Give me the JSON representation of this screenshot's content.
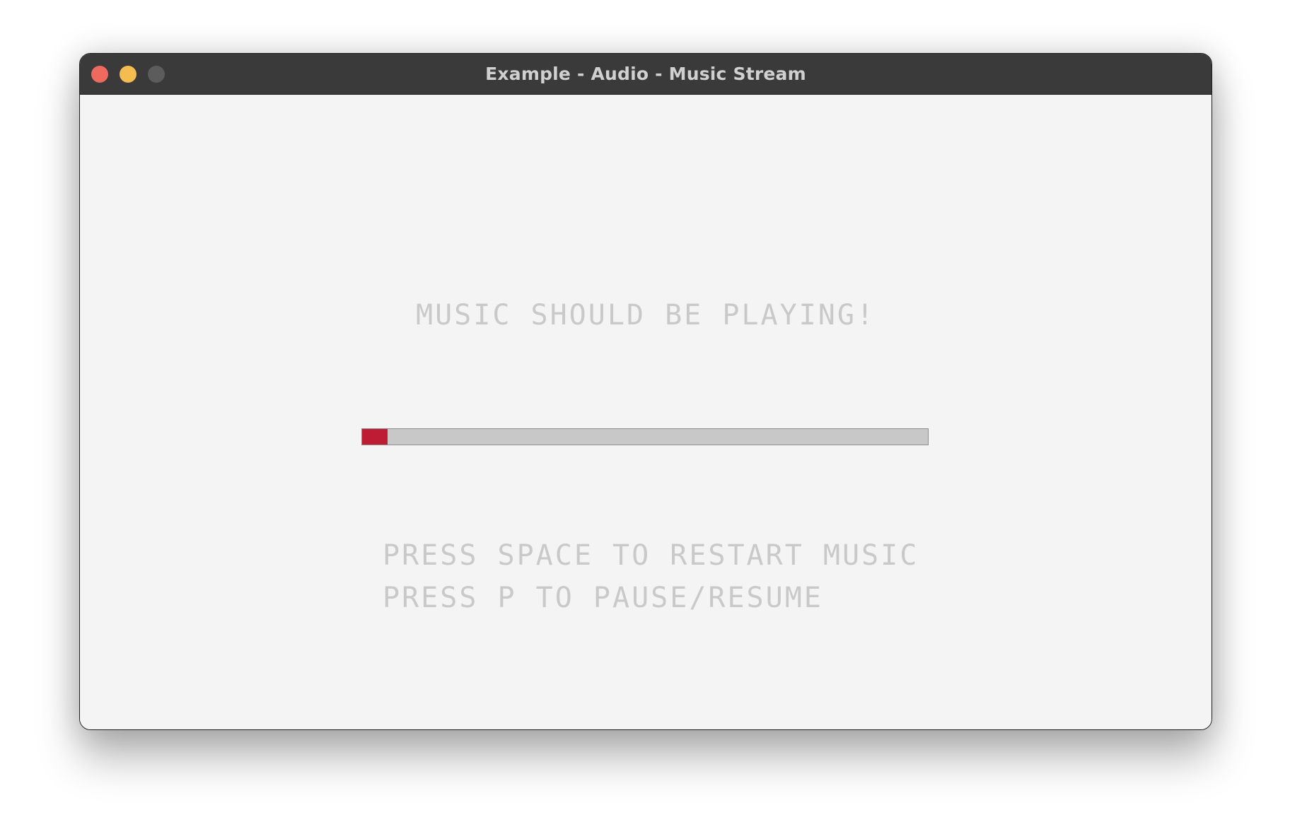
{
  "window": {
    "title": "Example - Audio - Music Stream"
  },
  "traffic_lights": {
    "close_color": "#ee6a5f",
    "minimize_color": "#f5bd4f",
    "zoom_color": "#5c5c5c"
  },
  "content": {
    "headline": "MUSIC SHOULD BE PLAYING!",
    "progress": {
      "value": 0.045,
      "fill_color": "#be1b35",
      "track_color": "#c8c8c8"
    },
    "hints": [
      "PRESS SPACE TO RESTART MUSIC",
      "PRESS P TO PAUSE/RESUME"
    ]
  }
}
